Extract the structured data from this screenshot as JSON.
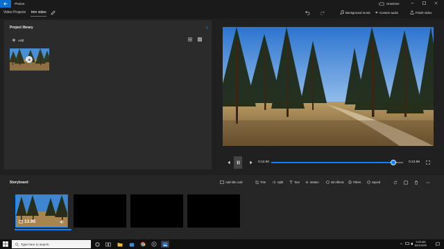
{
  "titlebar": {
    "app_name": "Photos",
    "account": "OneDrive"
  },
  "nav": {
    "breadcrumb_root": "Video Projects",
    "project_name": "trim video",
    "toolbar": {
      "background_music": "Background music",
      "custom_audio": "Custom audio",
      "finish_video": "Finish video"
    }
  },
  "library": {
    "title": "Project library",
    "add_label": "Add"
  },
  "player": {
    "current_time": "0:12.90",
    "total_time": "0:13.96",
    "progress_fraction": 0.924
  },
  "storyboard": {
    "title": "Storyboard",
    "tools": {
      "add_title_card": "Add title card",
      "trim": "Trim",
      "split": "Split",
      "text": "Text",
      "motion": "Motion",
      "effects_3d": "3D effects",
      "filters": "Filters",
      "speed": "Speed"
    },
    "clips": [
      {
        "duration": "13.95",
        "selected": true
      },
      {
        "duration": "",
        "selected": false
      },
      {
        "duration": "",
        "selected": false
      },
      {
        "duration": "",
        "selected": false
      }
    ]
  },
  "taskbar": {
    "search_placeholder": "Type here to search",
    "time": "9:25 AM",
    "date": "8/21/2020"
  },
  "colors": {
    "accent": "#0a84ff",
    "titlebar_back": "#0a6fd1",
    "panel": "#2b2b2b"
  }
}
